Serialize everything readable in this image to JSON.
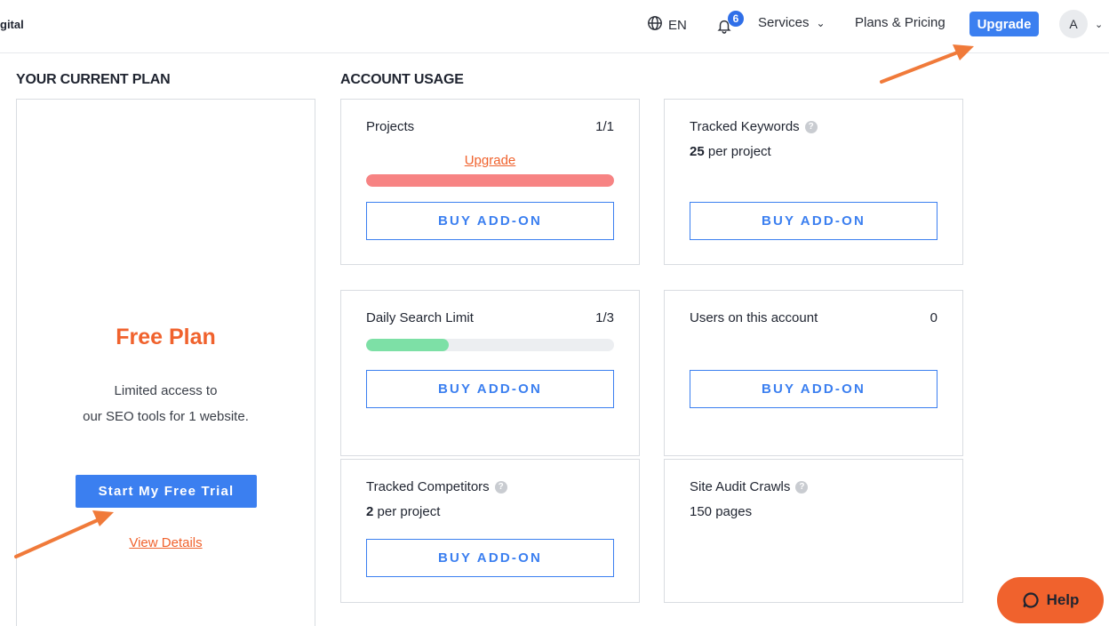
{
  "header": {
    "brand": "gital",
    "language": "EN",
    "notifications_count": "6",
    "services_label": "Services",
    "plans_label": "Plans & Pricing",
    "upgrade_label": "Upgrade",
    "avatar_initial": "A"
  },
  "plan": {
    "section_title": "YOUR CURRENT PLAN",
    "name": "Free Plan",
    "desc_line1": "Limited access to",
    "desc_line2": "our SEO tools for 1 website.",
    "trial_button": "Start My Free Trial",
    "details_link": "View Details"
  },
  "usage": {
    "section_title": "ACCOUNT USAGE",
    "cards": [
      {
        "label": "Projects",
        "count": "1/1",
        "link": "Upgrade",
        "bar_fraction": 1.0,
        "bar_color": "#f78383",
        "button": "BUY ADD-ON"
      },
      {
        "label": "Tracked Keywords",
        "sub_bold": "25",
        "sub_rest": " per project",
        "button": "BUY ADD-ON"
      },
      {
        "label": "Daily Search Limit",
        "count": "1/3",
        "bar_fraction": 0.333,
        "bar_color": "#7de0a6",
        "button": "BUY ADD-ON"
      },
      {
        "label": "Users on this account",
        "count": "0",
        "button": "BUY ADD-ON"
      },
      {
        "label": "Tracked Competitors",
        "sub_bold": "2",
        "sub_rest": " per project",
        "button": "BUY ADD-ON"
      },
      {
        "label": "Site Audit Crawls",
        "sub_rest": "150 pages"
      }
    ]
  },
  "help_label": "Help",
  "colors": {
    "accent_blue": "#3b7ff0",
    "accent_orange": "#f0622d",
    "arrow": "#f07a3a"
  },
  "icons": {
    "language": "globe-icon",
    "notifications": "bell-icon",
    "info": "info-icon",
    "help": "chat-bubble-icon"
  }
}
